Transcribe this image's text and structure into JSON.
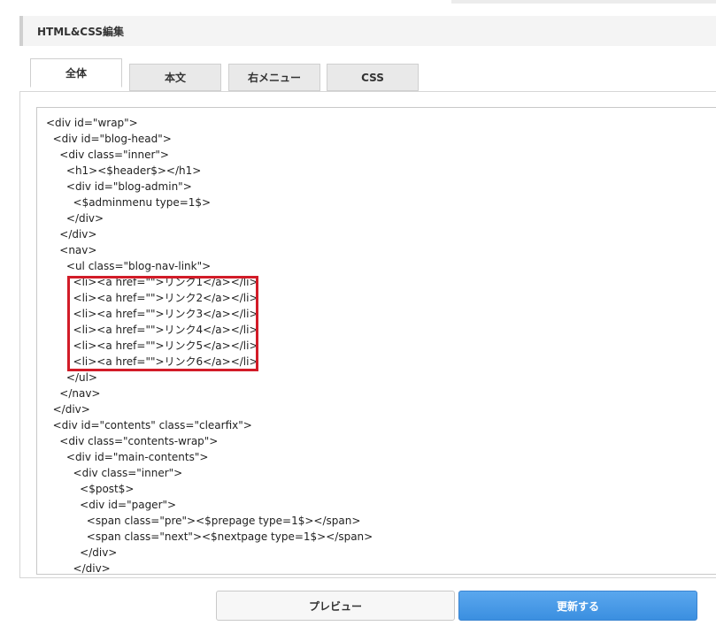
{
  "header": {
    "title": "HTML&CSS編集"
  },
  "tabs": [
    {
      "label": "全体",
      "active": true
    },
    {
      "label": "本文",
      "active": false
    },
    {
      "label": "右メニュー",
      "active": false
    },
    {
      "label": "CSS",
      "active": false
    }
  ],
  "code_lines": [
    "<div id=\"wrap\">",
    "  <div id=\"blog-head\">",
    "    <div class=\"inner\">",
    "      <h1><$header$></h1>",
    "      <div id=\"blog-admin\">",
    "        <$adminmenu type=1$>",
    "      </div>",
    "    </div>",
    "    <nav>",
    "      <ul class=\"blog-nav-link\">",
    "        <li><a href=\"\">リンク1</a></li>",
    "        <li><a href=\"\">リンク2</a></li>",
    "        <li><a href=\"\">リンク3</a></li>",
    "        <li><a href=\"\">リンク4</a></li>",
    "        <li><a href=\"\">リンク5</a></li>",
    "        <li><a href=\"\">リンク6</a></li>",
    "      </ul>",
    "    </nav>",
    "  </div>",
    "  <div id=\"contents\" class=\"clearfix\">",
    "    <div class=\"contents-wrap\">",
    "      <div id=\"main-contents\">",
    "        <div class=\"inner\">",
    "          <$post$>",
    "          <div id=\"pager\">",
    "            <span class=\"pre\"><$prepage type=1$></span>",
    "            <span class=\"next\"><$nextpage type=1$></span>",
    "          </div>",
    "        </div>"
  ],
  "buttons": {
    "preview": "プレビュー",
    "update": "更新する"
  },
  "colors": {
    "highlight": "#d21c28",
    "update_button": "#3b8fe0"
  }
}
